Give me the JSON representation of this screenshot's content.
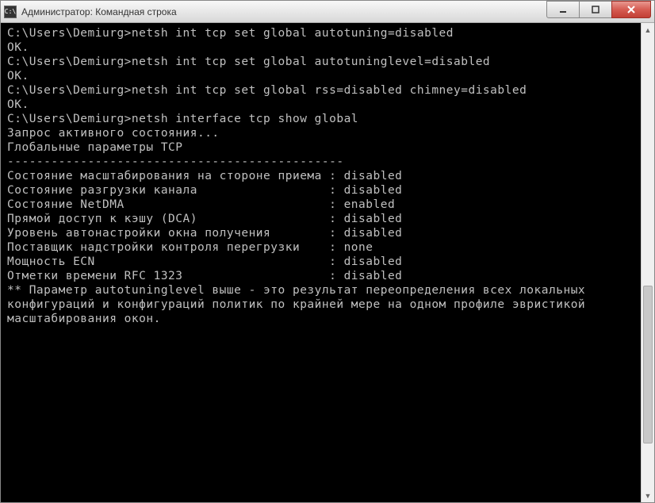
{
  "window": {
    "title": "Администратор: Командная строка",
    "icon_text": "C:\\"
  },
  "terminal": {
    "blank1": "",
    "prompt1": "C:\\Users\\Demiurg>netsh int tcp set global autotuning=disabled",
    "ok1": "OK.",
    "blank2": "",
    "blank3": "",
    "prompt2": "C:\\Users\\Demiurg>netsh int tcp set global autotuninglevel=disabled",
    "ok2": "OK.",
    "blank4": "",
    "blank5": "",
    "prompt3": "C:\\Users\\Demiurg>netsh int tcp set global rss=disabled chimney=disabled",
    "ok3": "OK.",
    "blank6": "",
    "blank7": "",
    "prompt4": "C:\\Users\\Demiurg>netsh interface tcp show global",
    "query": "Запрос активного состояния...",
    "blank8": "",
    "header": "Глобальные параметры TCP",
    "divider": "----------------------------------------------",
    "param1": "Состояние масштабирования на стороне приема : disabled",
    "param2": "Состояние разгрузки канала                  : disabled",
    "param3": "Состояние NetDMA                            : enabled",
    "param4": "Прямой доступ к кэшу (DCA)                  : disabled",
    "param5": "Уровень автонастройки окна получения        : disabled",
    "param6": "Поставщик надстройки контроля перегрузки    : none",
    "param7": "Мощность ECN                                : disabled",
    "param8": "Отметки времени RFC 1323                    : disabled",
    "note1": "** Параметр autotuninglevel выше - это результат переопределения всех локальных",
    "note2": "конфигураций и конфигураций политик по крайней мере на одном профиле эвристикой",
    "note3": "масштабирования окон."
  }
}
